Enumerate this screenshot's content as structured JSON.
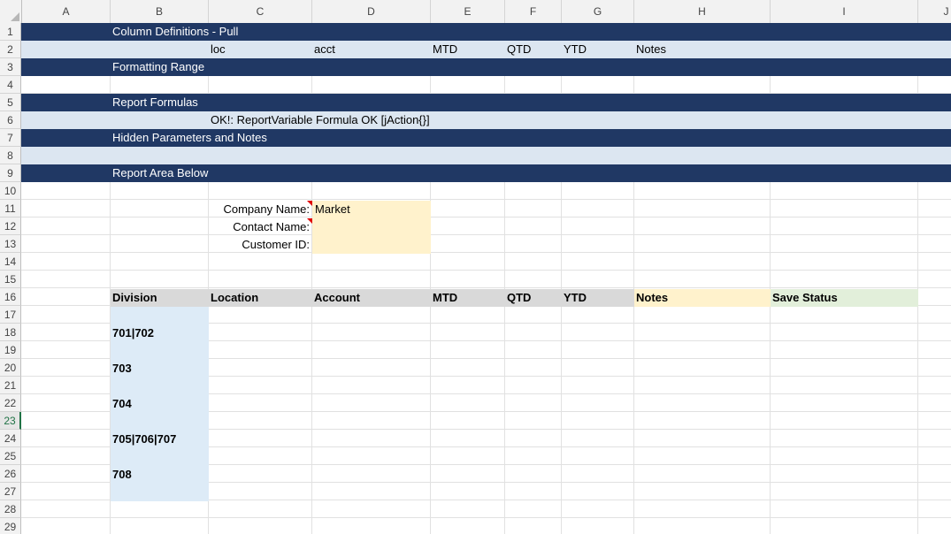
{
  "columns": [
    "A",
    "B",
    "C",
    "D",
    "E",
    "F",
    "G",
    "H",
    "I",
    "J"
  ],
  "rows": [
    "1",
    "2",
    "3",
    "4",
    "5",
    "6",
    "7",
    "8",
    "9",
    "10",
    "11",
    "12",
    "13",
    "14",
    "15",
    "16",
    "17",
    "18",
    "19",
    "20",
    "21",
    "22",
    "23",
    "24",
    "25",
    "26",
    "27",
    "28",
    "29"
  ],
  "active_row": "23",
  "bands": {
    "row1": "Column Definitions - Pull",
    "row2": [
      "loc",
      "acct",
      "MTD",
      "QTD",
      "YTD",
      "Notes"
    ],
    "row3": "Formatting Range",
    "row5": "Report Formulas",
    "row6": "OK!: ReportVariable Formula OK [jAction{}]",
    "row7": "Hidden Parameters and Notes",
    "row9": "Report Area Below"
  },
  "params": {
    "company_label": "Company Name:",
    "company_value": "Market",
    "contact_label": "Contact Name:",
    "contact_value": "",
    "customer_label": "Customer ID:",
    "customer_value": ""
  },
  "table": {
    "headers": [
      "Division",
      "Location",
      "Account",
      "MTD",
      "QTD",
      "YTD",
      "Notes",
      "Save Status"
    ],
    "divisions": [
      "701|702",
      "703",
      "704",
      "705|706|707",
      "708"
    ]
  },
  "colors": {
    "band_dark": "#203864",
    "band_light": "#dce6f1",
    "input_fill": "#fff2cc",
    "header_fill": "#d9d9d9",
    "save_status_fill": "#e2efda",
    "division_fill": "#ddebf7"
  }
}
